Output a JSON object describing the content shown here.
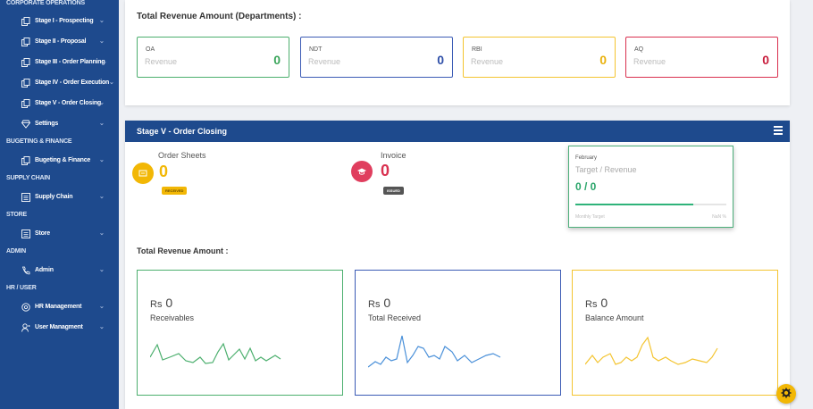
{
  "sidebar": {
    "sections": {
      "corporate": "CORPORATE OPERATIONS",
      "budgeting": "BUGETING & FINANCE",
      "supply": "SUPPLY CHAIN",
      "store": "STORE",
      "admin": "ADMIN",
      "hr": "HR / USER"
    },
    "items": [
      {
        "label": "Stage I - Prospecting",
        "icon": "copy-icon"
      },
      {
        "label": "Stage II - Proposal",
        "icon": "copy-icon"
      },
      {
        "label": "Stage III - Order Planning",
        "icon": "copy-icon"
      },
      {
        "label": "Stage IV - Order Execution",
        "icon": "copy-icon"
      },
      {
        "label": "Stage V - Order Closing",
        "icon": "copy-icon"
      },
      {
        "label": "Settings",
        "icon": "diamond-icon"
      },
      {
        "label": "Bugeting & Finance",
        "icon": "copy-icon"
      },
      {
        "label": "Supply Chain",
        "icon": "box-icon"
      },
      {
        "label": "Store",
        "icon": "box-icon"
      },
      {
        "label": "Admin",
        "icon": "phone-icon"
      },
      {
        "label": "HR Management",
        "icon": "cog-icon"
      },
      {
        "label": "User Managment",
        "icon": "user-icon"
      }
    ]
  },
  "departments": {
    "title": "Total Revenue Amount (Departments) :",
    "cards": [
      {
        "code": "OA",
        "label": "Revenue",
        "value": "0",
        "color": "#4caf6e"
      },
      {
        "code": "NDT",
        "label": "Revenue",
        "value": "0",
        "color": "#3b5bb5"
      },
      {
        "code": "RBI",
        "label": "Revenue",
        "value": "0",
        "color": "#f4c430"
      },
      {
        "code": "AQ",
        "label": "Revenue",
        "value": "0",
        "color": "#d9304f"
      }
    ]
  },
  "stage5": {
    "title": "Stage V - Order Closing",
    "order_sheets": {
      "label": "Order Sheets",
      "value": "0",
      "badge": "RECEIVED"
    },
    "invoice": {
      "label": "Invoice",
      "value": "0",
      "badge": "ISSUED"
    },
    "target": {
      "month": "February",
      "label": "Target / Revenue",
      "ratio": "0 / 0",
      "progress": 0.78,
      "monthly_label": "Monthly Target",
      "pct_label": "NaN %"
    },
    "revenue_title": "Total Revenue Amount :",
    "revenue_cards": [
      {
        "currency": "Rs",
        "amount": "0",
        "label": "Receivables",
        "color": "#4caf6e"
      },
      {
        "currency": "Rs",
        "amount": "0",
        "label": "Total Received",
        "color": "#3b5bb5"
      },
      {
        "currency": "Rs",
        "amount": "0",
        "label": "Balance Amount",
        "color": "#f4c430"
      }
    ]
  }
}
